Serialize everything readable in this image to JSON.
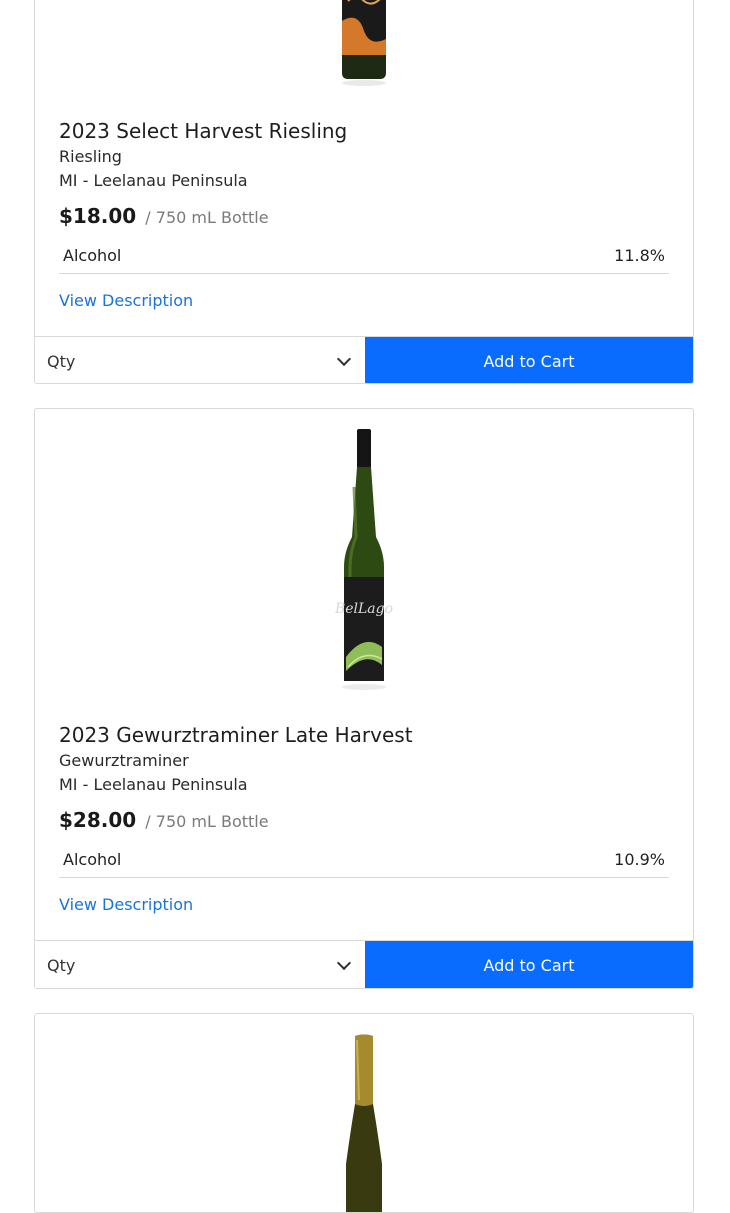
{
  "products": [
    {
      "title": "2023 Select Harvest Riesling",
      "varietal": "Riesling",
      "region": "MI - Leelanau Peninsula",
      "price": "$18.00",
      "unit": "/ 750 mL Bottle",
      "spec_label": "Alcohol",
      "spec_value": "11.8%",
      "link": "View Description",
      "qty_label": "Qty",
      "cart_label": "Add to Cart",
      "bottle_color": "#1f2a14",
      "label_color": "#d4782a"
    },
    {
      "title": "2023 Gewurztraminer Late Harvest",
      "varietal": "Gewurztraminer",
      "region": "MI - Leelanau Peninsula",
      "price": "$28.00",
      "unit": "/ 750 mL Bottle",
      "spec_label": "Alcohol",
      "spec_value": "10.9%",
      "link": "View Description",
      "qty_label": "Qty",
      "cart_label": "Add to Cart",
      "bottle_color": "#2c4a12",
      "label_color": "#1c1c1c"
    },
    {
      "bottle_color": "#3a3a10",
      "capsule_color": "#a58a2e"
    }
  ],
  "accent_color": "#0a6cff",
  "link_color": "#1a73d9"
}
